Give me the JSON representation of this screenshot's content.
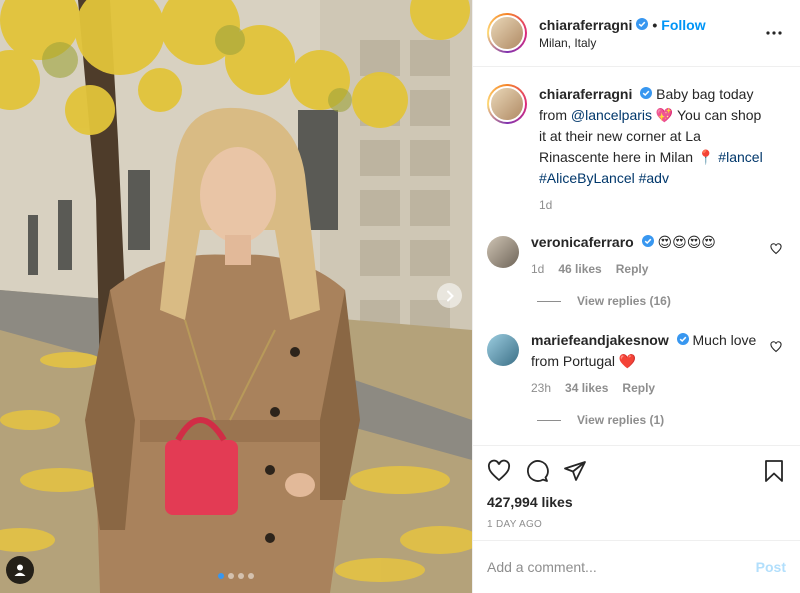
{
  "post": {
    "username": "chiaraferragni",
    "follow_separator": "•",
    "follow_label": "Follow",
    "location": "Milan, Italy",
    "carousel": {
      "slide_count": 4,
      "active_index": 0
    }
  },
  "caption": {
    "username": "chiaraferragni",
    "text_part1": "Baby bag today from ",
    "mention": "@lancelparis",
    "emoji_heart": "💖",
    "text_part2": " You can shop it at their new corner at La Rinascente here in Milan ",
    "emoji_pin": "📍",
    "hashtags": " #lancel #AliceByLancel #adv",
    "time": "1d"
  },
  "comments": [
    {
      "username": "veronicaferraro",
      "text": "😍😍😍😍",
      "time": "1d",
      "likes": "46 likes",
      "reply_label": "Reply",
      "view_replies": "View replies (16)"
    },
    {
      "username": "mariefeandjakesnow",
      "text": "Much love from Portugal ❤️",
      "time": "23h",
      "likes": "34 likes",
      "reply_label": "Reply",
      "view_replies": "View replies (1)"
    }
  ],
  "engagement": {
    "likes": "427,994 likes",
    "date": "1 DAY AGO"
  },
  "composer": {
    "placeholder": "Add a comment...",
    "post_label": "Post"
  },
  "icons": {
    "verified": "verified-badge-icon",
    "more": "more-options-icon",
    "like": "heart-icon",
    "comment": "comment-icon",
    "share": "paper-plane-icon",
    "save": "bookmark-icon",
    "next": "chevron-right-icon",
    "tags": "user-tag-icon"
  },
  "colors": {
    "accent": "#0095f6",
    "verified": "#3897f0",
    "muted": "#8e8e8e",
    "mention": "#00376b"
  }
}
